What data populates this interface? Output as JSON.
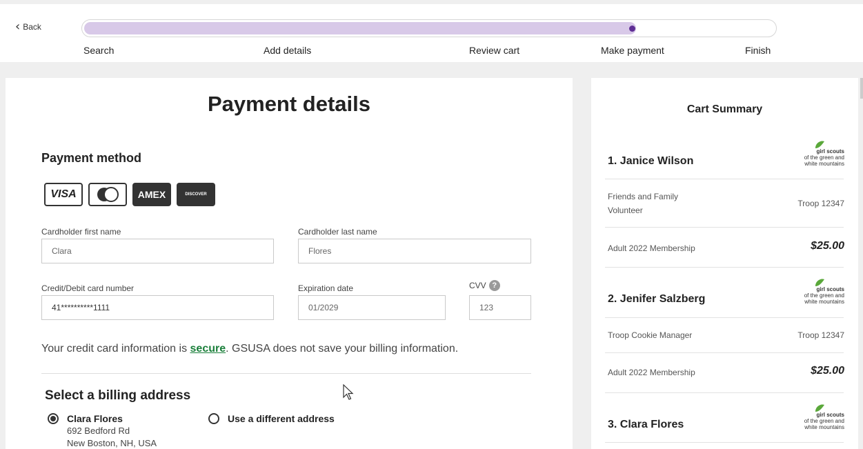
{
  "header": {
    "back_label": "Back",
    "progress_percent": 80,
    "steps": [
      "Search",
      "Add details",
      "Review cart",
      "Make payment",
      "Finish"
    ]
  },
  "main": {
    "title": "Payment details",
    "payment_method_title": "Payment method",
    "cards": [
      "VISA",
      "mastercard",
      "AMEX",
      "DISCOVER"
    ],
    "first_name": {
      "label": "Cardholder first name",
      "value": "Clara"
    },
    "last_name": {
      "label": "Cardholder last name",
      "value": "Flores"
    },
    "card_number": {
      "label": "Credit/Debit card number",
      "value": "41**********1111"
    },
    "expiration": {
      "label": "Expiration date",
      "value": "01/2029"
    },
    "cvv": {
      "label": "CVV",
      "value": "123"
    },
    "secure_note_before": "Your credit card information is ",
    "secure_link": "secure",
    "secure_note_after": ". GSUSA does not save your billing information.",
    "billing_title": "Select a billing address",
    "address_option": {
      "name": "Clara Flores",
      "line1": "692 Bedford Rd",
      "line2": "New Boston, NH, USA",
      "selected": true
    },
    "different_address_label": "Use a different address"
  },
  "cart": {
    "title": "Cart Summary",
    "logo_text": {
      "brand": "girl scouts",
      "line1": "of the green and",
      "line2": "white mountains"
    },
    "items": [
      {
        "name": "1. Janice Wilson",
        "role_line1": "Friends and Family",
        "role_line2": "Volunteer",
        "troop": "Troop 12347",
        "membership": "Adult 2022 Membership",
        "price": "$25.00"
      },
      {
        "name": "2. Jenifer Salzberg",
        "role_line1": "Troop Cookie Manager",
        "role_line2": "",
        "troop": "Troop 12347",
        "membership": "Adult 2022 Membership",
        "price": "$25.00"
      },
      {
        "name": "3. Clara Flores"
      }
    ]
  },
  "colors": {
    "accent_purple": "#5f2e95",
    "progress_fill": "#d8c9e8",
    "link_green": "#1a7f3a",
    "clover_green": "#5aa83a"
  }
}
